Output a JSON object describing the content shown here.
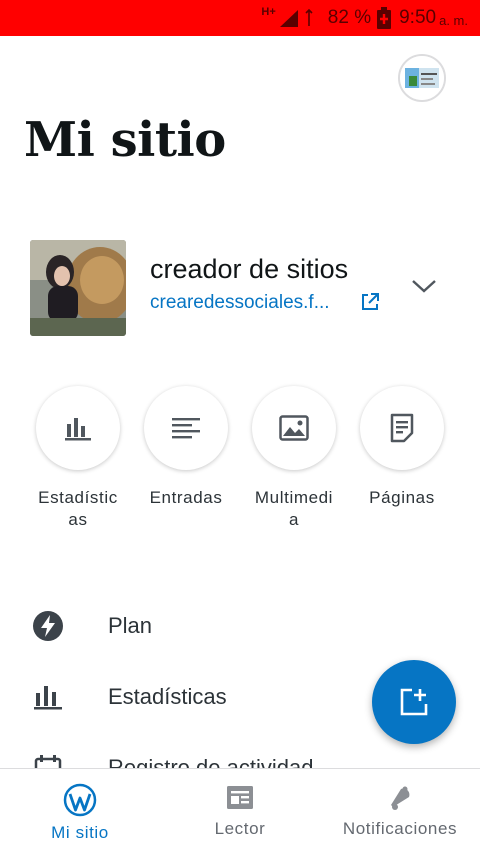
{
  "colors": {
    "status_bar": "#ff0000",
    "accent": "#0675c4",
    "text": "#2c3338",
    "muted": "#646970"
  },
  "status_bar": {
    "network": "H+",
    "battery": "82 %",
    "time": "9:50",
    "ampm": "a. m."
  },
  "header": {
    "title": "Mi sitio",
    "avatar_icon": "site-avatar-image"
  },
  "site": {
    "name": "creador de sitios",
    "url": "crearedessociales.f...",
    "thumbnail": "site-photo"
  },
  "quick_actions": [
    {
      "label": "Estadísticas",
      "icon": "stats-icon"
    },
    {
      "label": "Entradas",
      "icon": "posts-icon"
    },
    {
      "label": "Multimedia",
      "icon": "media-icon"
    },
    {
      "label": "Páginas",
      "icon": "pages-icon"
    }
  ],
  "menu": [
    {
      "label": "Plan",
      "icon": "plan-icon"
    },
    {
      "label": "Estadísticas",
      "icon": "stats-icon"
    },
    {
      "label": "Registro de actividad",
      "icon": "activity-icon"
    }
  ],
  "fab": {
    "icon": "new-post-icon"
  },
  "bottom_nav": [
    {
      "label": "Mi sitio",
      "icon": "wordpress-icon",
      "active": true
    },
    {
      "label": "Lector",
      "icon": "reader-icon",
      "active": false
    },
    {
      "label": "Notificaciones",
      "icon": "bell-icon",
      "active": false
    }
  ]
}
